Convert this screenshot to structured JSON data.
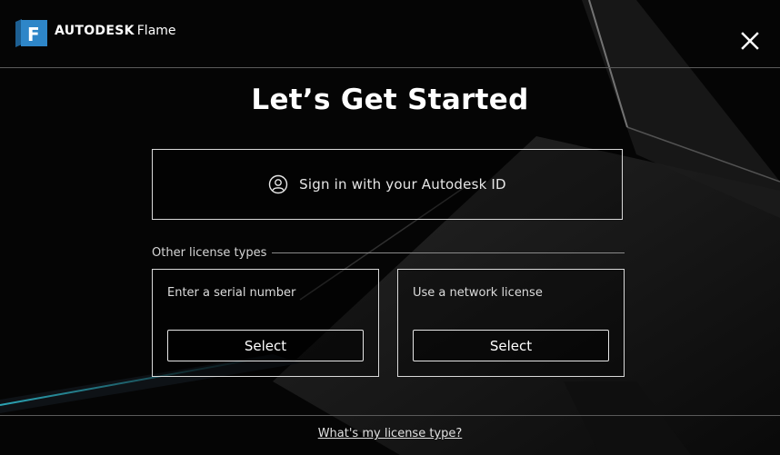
{
  "header": {
    "logo_letter": "F",
    "brand": "AUTODESK",
    "product": "Flame",
    "close_icon": "close-icon"
  },
  "main": {
    "title": "Let’s Get Started",
    "signin": {
      "icon": "user-circle-icon",
      "label": "Sign in with your Autodesk ID"
    },
    "other_heading": "Other license types",
    "options": [
      {
        "label": "Enter a serial number",
        "button": "Select"
      },
      {
        "label": "Use a network license",
        "button": "Select"
      }
    ]
  },
  "footer": {
    "link": "What's my license type?"
  },
  "colors": {
    "background": "#050505",
    "logo_blue": "#2e86c8",
    "accent_glow": "#2fb6c8"
  }
}
